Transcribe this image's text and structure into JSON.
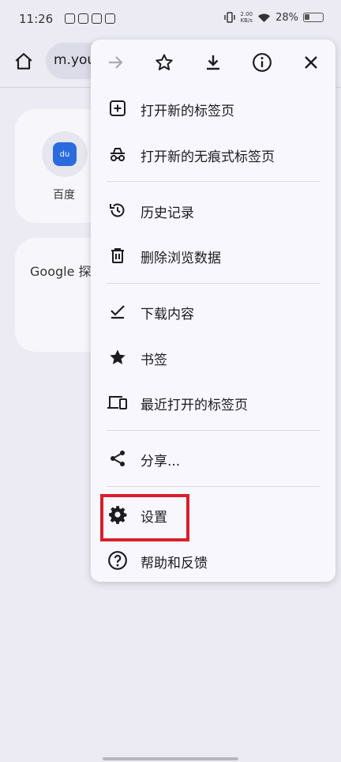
{
  "status_bar": {
    "time": "11:26",
    "speed_value": "2.00",
    "speed_unit": "KB/s",
    "battery": "28%"
  },
  "toolbar": {
    "url": "m.you"
  },
  "shortcuts": {
    "baidu_label": "百度",
    "baidu_logo": "du"
  },
  "card2_text": "Google 探",
  "menu": {
    "items": [
      {
        "label": "打开新的标签页",
        "icon": "new-tab-icon"
      },
      {
        "label": "打开新的无痕式标签页",
        "icon": "incognito-icon"
      },
      {
        "label": "历史记录",
        "icon": "history-icon"
      },
      {
        "label": "删除浏览数据",
        "icon": "trash-icon"
      },
      {
        "label": "下载内容",
        "icon": "download-done-icon"
      },
      {
        "label": "书签",
        "icon": "star-filled-icon"
      },
      {
        "label": "最近打开的标签页",
        "icon": "devices-icon"
      },
      {
        "label": "分享...",
        "icon": "share-icon"
      },
      {
        "label": "设置",
        "icon": "gear-icon"
      },
      {
        "label": "帮助和反馈",
        "icon": "help-icon"
      }
    ]
  },
  "colors": {
    "highlight": "#d71f2b",
    "menu_bg": "#f7f7fd",
    "page_bg": "#ECEBF4"
  }
}
